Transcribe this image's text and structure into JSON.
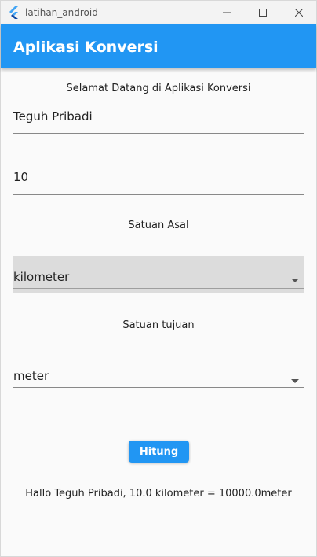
{
  "window": {
    "title": "latihan_android"
  },
  "appbar": {
    "title": "Aplikasi Konversi"
  },
  "main": {
    "welcome": "Selamat Datang di Aplikasi Konversi",
    "name_field_value": "Teguh Pribadi",
    "value_field_value": "10",
    "satuan_asal_label": "Satuan Asal",
    "satuan_asal_selected": "kilometer",
    "satuan_tujuan_label": "Satuan tujuan",
    "satuan_tujuan_selected": "meter",
    "hitung_button": "Hitung",
    "result": "Hallo Teguh Pribadi, 10.0 kilometer = 10000.0meter"
  },
  "colors": {
    "primary": "#2196f3",
    "background": "#fafafa",
    "dropdown_focus_bg": "#dcdcdc"
  },
  "icons": [
    "flutter-logo-icon",
    "minimize-icon",
    "maximize-icon",
    "close-icon",
    "dropdown-arrow-icon"
  ]
}
